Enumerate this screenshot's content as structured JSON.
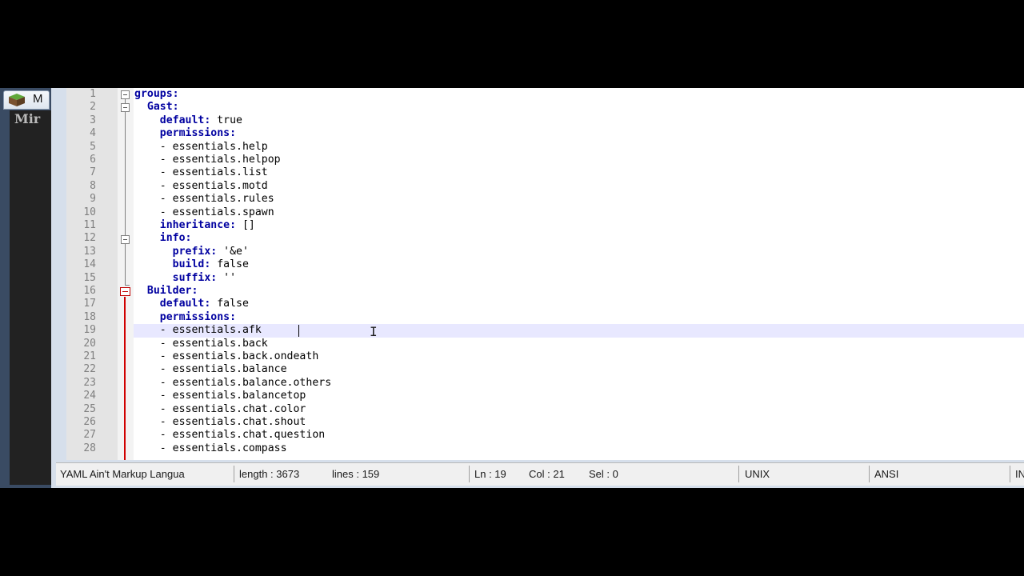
{
  "background_window": {
    "tab_label": "M",
    "body_label": "Mir"
  },
  "editor": {
    "lines": [
      {
        "n": "1",
        "indent": "",
        "key": "groups:",
        "val": ""
      },
      {
        "n": "2",
        "indent": "  ",
        "key": "Gast:",
        "val": ""
      },
      {
        "n": "3",
        "indent": "    ",
        "key": "default:",
        "val": " true"
      },
      {
        "n": "4",
        "indent": "    ",
        "key": "permissions:",
        "val": ""
      },
      {
        "n": "5",
        "indent": "    ",
        "key": "",
        "val": "- essentials.help"
      },
      {
        "n": "6",
        "indent": "    ",
        "key": "",
        "val": "- essentials.helpop"
      },
      {
        "n": "7",
        "indent": "    ",
        "key": "",
        "val": "- essentials.list"
      },
      {
        "n": "8",
        "indent": "    ",
        "key": "",
        "val": "- essentials.motd"
      },
      {
        "n": "9",
        "indent": "    ",
        "key": "",
        "val": "- essentials.rules"
      },
      {
        "n": "10",
        "indent": "    ",
        "key": "",
        "val": "- essentials.spawn"
      },
      {
        "n": "11",
        "indent": "    ",
        "key": "inheritance:",
        "val": " []"
      },
      {
        "n": "12",
        "indent": "    ",
        "key": "info:",
        "val": ""
      },
      {
        "n": "13",
        "indent": "      ",
        "key": "prefix:",
        "val": " '&e'"
      },
      {
        "n": "14",
        "indent": "      ",
        "key": "build:",
        "val": " false"
      },
      {
        "n": "15",
        "indent": "      ",
        "key": "suffix:",
        "val": " ''"
      },
      {
        "n": "16",
        "indent": "  ",
        "key": "Builder:",
        "val": ""
      },
      {
        "n": "17",
        "indent": "    ",
        "key": "default:",
        "val": " false"
      },
      {
        "n": "18",
        "indent": "    ",
        "key": "permissions:",
        "val": ""
      },
      {
        "n": "19",
        "indent": "    ",
        "key": "",
        "val": "- essentials.afk"
      },
      {
        "n": "20",
        "indent": "    ",
        "key": "",
        "val": "- essentials.back"
      },
      {
        "n": "21",
        "indent": "    ",
        "key": "",
        "val": "- essentials.back.ondeath"
      },
      {
        "n": "22",
        "indent": "    ",
        "key": "",
        "val": "- essentials.balance"
      },
      {
        "n": "23",
        "indent": "    ",
        "key": "",
        "val": "- essentials.balance.others"
      },
      {
        "n": "24",
        "indent": "    ",
        "key": "",
        "val": "- essentials.balancetop"
      },
      {
        "n": "25",
        "indent": "    ",
        "key": "",
        "val": "- essentials.chat.color"
      },
      {
        "n": "26",
        "indent": "    ",
        "key": "",
        "val": "- essentials.chat.shout"
      },
      {
        "n": "27",
        "indent": "    ",
        "key": "",
        "val": "- essentials.chat.question"
      },
      {
        "n": "28",
        "indent": "    ",
        "key": "",
        "val": "- essentials.compass"
      }
    ],
    "current_line": 19
  },
  "statusbar": {
    "language": "YAML Ain't Markup Langua",
    "length": "length : 3673",
    "lines": "lines : 159",
    "ln": "Ln : 19",
    "col": "Col : 21",
    "sel": "Sel : 0",
    "eol": "UNIX",
    "encoding": "ANSI",
    "mode": "IN"
  },
  "colors": {
    "key": "#0000a0",
    "fold_active": "#d00000",
    "current_line": "#e8e8ff"
  }
}
